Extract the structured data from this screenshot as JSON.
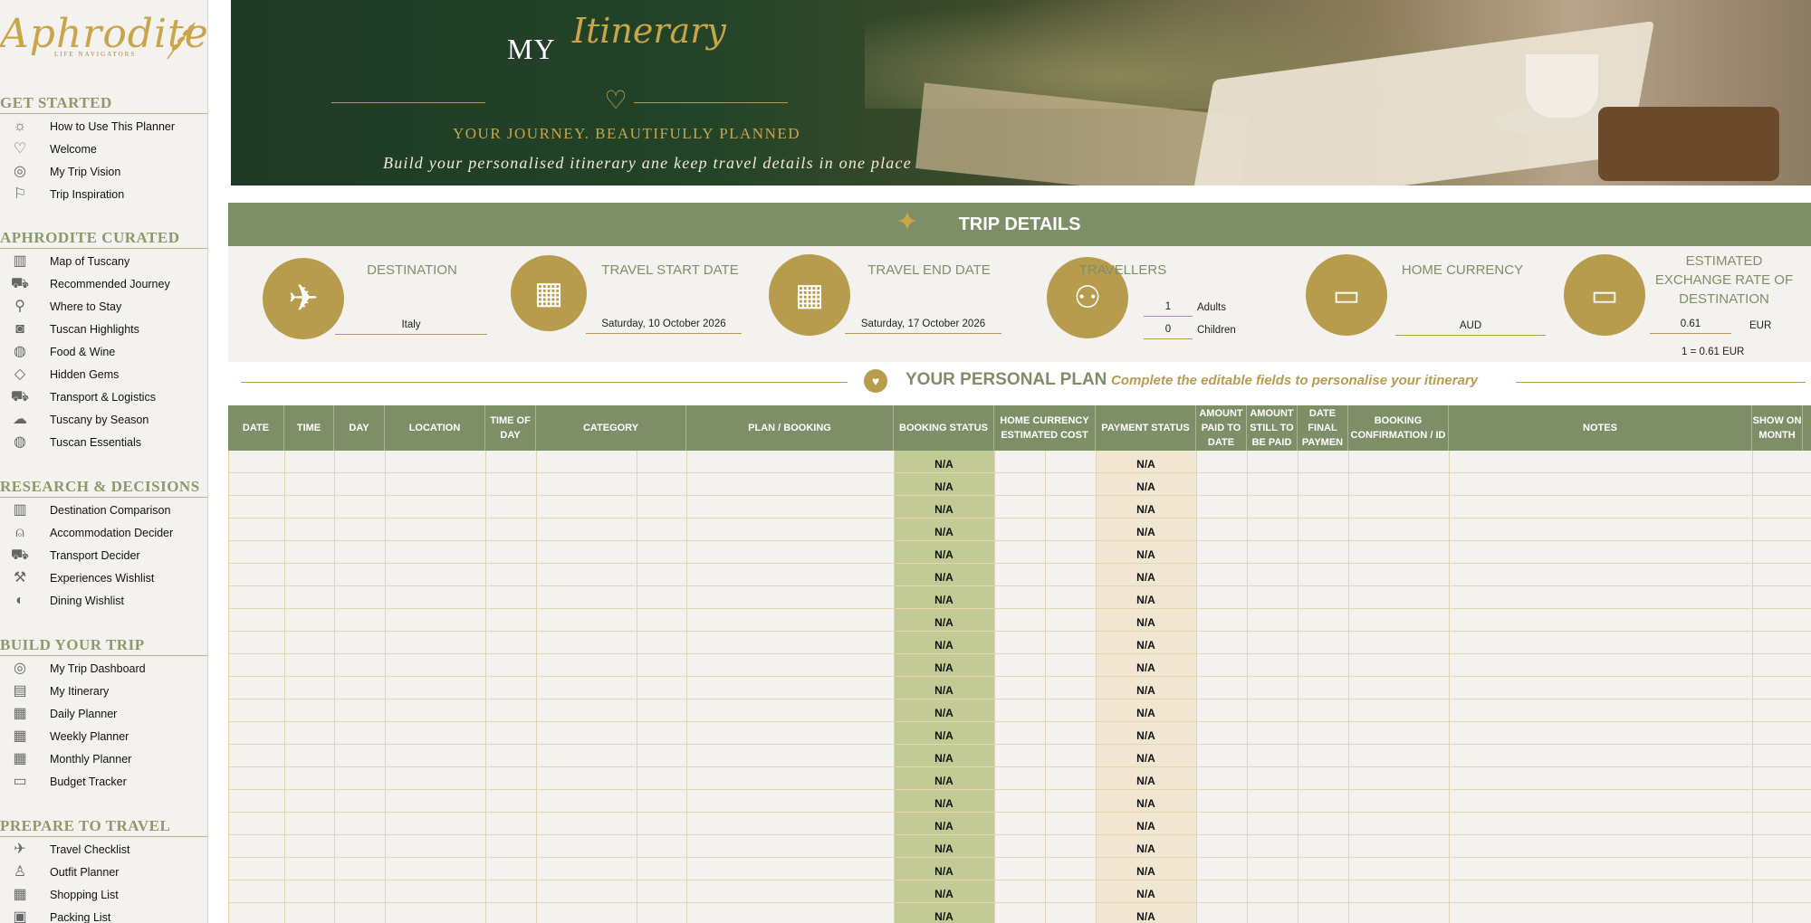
{
  "brand": {
    "name": "Aphrodite",
    "tagline": "LIFE NAVIGATORS"
  },
  "sidebar": {
    "sections": [
      {
        "title": "GET STARTED",
        "items": [
          {
            "label": "How to Use This Planner",
            "icon": "sun-icon"
          },
          {
            "label": "Welcome",
            "icon": "heart-icon"
          },
          {
            "label": "My Trip Vision",
            "icon": "target-icon"
          },
          {
            "label": "Trip Inspiration",
            "icon": "traveler-icon"
          }
        ]
      },
      {
        "title": "APHRODITE CURATED",
        "items": [
          {
            "label": "Map of Tuscany",
            "icon": "map-icon"
          },
          {
            "label": "Recommended Journey",
            "icon": "car-icon"
          },
          {
            "label": "Where to Stay",
            "icon": "pin-icon"
          },
          {
            "label": "Tuscan Highlights",
            "icon": "camera-icon"
          },
          {
            "label": "Food & Wine",
            "icon": "pizza-icon"
          },
          {
            "label": "Hidden Gems",
            "icon": "gem-icon"
          },
          {
            "label": "Transport & Logistics",
            "icon": "car-icon"
          },
          {
            "label": "Tuscany by Season",
            "icon": "weather-icon"
          },
          {
            "label": "Tuscan Essentials",
            "icon": "globe-icon"
          }
        ]
      },
      {
        "title": "RESEARCH & DECISIONS",
        "items": [
          {
            "label": "Destination Comparison",
            "icon": "map-icon"
          },
          {
            "label": "Accommodation Decider",
            "icon": "bell-icon"
          },
          {
            "label": "Transport Decider",
            "icon": "car-icon"
          },
          {
            "label": "Experiences Wishlist",
            "icon": "hiker-icon"
          },
          {
            "label": "Dining  Wishlist",
            "icon": "dining-icon"
          }
        ]
      },
      {
        "title": "BUILD YOUR TRIP",
        "items": [
          {
            "label": "My Trip Dashboard",
            "icon": "target-icon"
          },
          {
            "label": "My Itinerary",
            "icon": "itinerary-icon"
          },
          {
            "label": "Daily Planner",
            "icon": "calendar-icon"
          },
          {
            "label": "Weekly Planner",
            "icon": "calendar-icon"
          },
          {
            "label": "Monthly Planner",
            "icon": "calendar-icon"
          },
          {
            "label": "Budget Tracker",
            "icon": "money-icon"
          }
        ]
      },
      {
        "title": "PREPARE TO TRAVEL",
        "items": [
          {
            "label": "Travel Checklist",
            "icon": "plane-icon"
          },
          {
            "label": "Outfit Planner",
            "icon": "dress-icon"
          },
          {
            "label": "Shopping List",
            "icon": "grid-icon"
          },
          {
            "label": "Packing List",
            "icon": "luggage-icon"
          }
        ]
      }
    ]
  },
  "hero": {
    "my": "MY",
    "title": "Itinerary",
    "tagline": "YOUR JOURNEY. BEAUTIFULLY PLANNED",
    "subtitle": "Build your personalised itinerary ane keep travel details in one place"
  },
  "trip": {
    "title": "TRIP DETAILS",
    "destination": {
      "label": "DESTINATION",
      "value": "Italy",
      "icon": "airplane-icon"
    },
    "start": {
      "label": "TRAVEL START DATE",
      "value": "Saturday, 10 October 2026",
      "icon": "calendar-icon"
    },
    "end": {
      "label": "TRAVEL END DATE",
      "value": "Saturday, 17 October 2026",
      "icon": "calendar-icon"
    },
    "travellers": {
      "label": "TRAVELLERS",
      "adults_count": "1",
      "adults_label": "Adults",
      "children_count": "0",
      "children_label": "Children",
      "icon": "people-icon"
    },
    "currency": {
      "label": "HOME CURRENCY",
      "value": "AUD",
      "icon": "cash-icon"
    },
    "rate": {
      "label": "ESTIMATED EXCHANGE RATE OF DESTINATION",
      "value": "0.61",
      "unit": "EUR",
      "note": "1 = 0.61 EUR",
      "icon": "cash-icon"
    }
  },
  "plan": {
    "title": "YOUR PERSONAL PLAN",
    "subtitle": "Complete the editable fields to personalise your itinerary",
    "columns": [
      "DATE",
      "TIME",
      "DAY",
      "LOCATION",
      "TIME OF DAY",
      "CATEGORY",
      "PLAN / BOOKING",
      "BOOKING STATUS",
      "HOME CURRENCY ESTIMATED COST",
      "PAYMENT STATUS",
      "AMOUNT PAID TO DATE",
      "AMOUNT STILL TO BE PAID",
      "DATE FINAL PAYMEN",
      "BOOKING CONFIRMATION / ID",
      "NOTES",
      "SHOW ON MONTH"
    ],
    "na_value": "N/A",
    "row_count": 21
  },
  "colors": {
    "accent_green": "#7e8f68",
    "gold": "#b89c4e",
    "status_green": "#c2ca95",
    "payment_beige": "#f0e6d2",
    "background": "#f4f2ee"
  }
}
